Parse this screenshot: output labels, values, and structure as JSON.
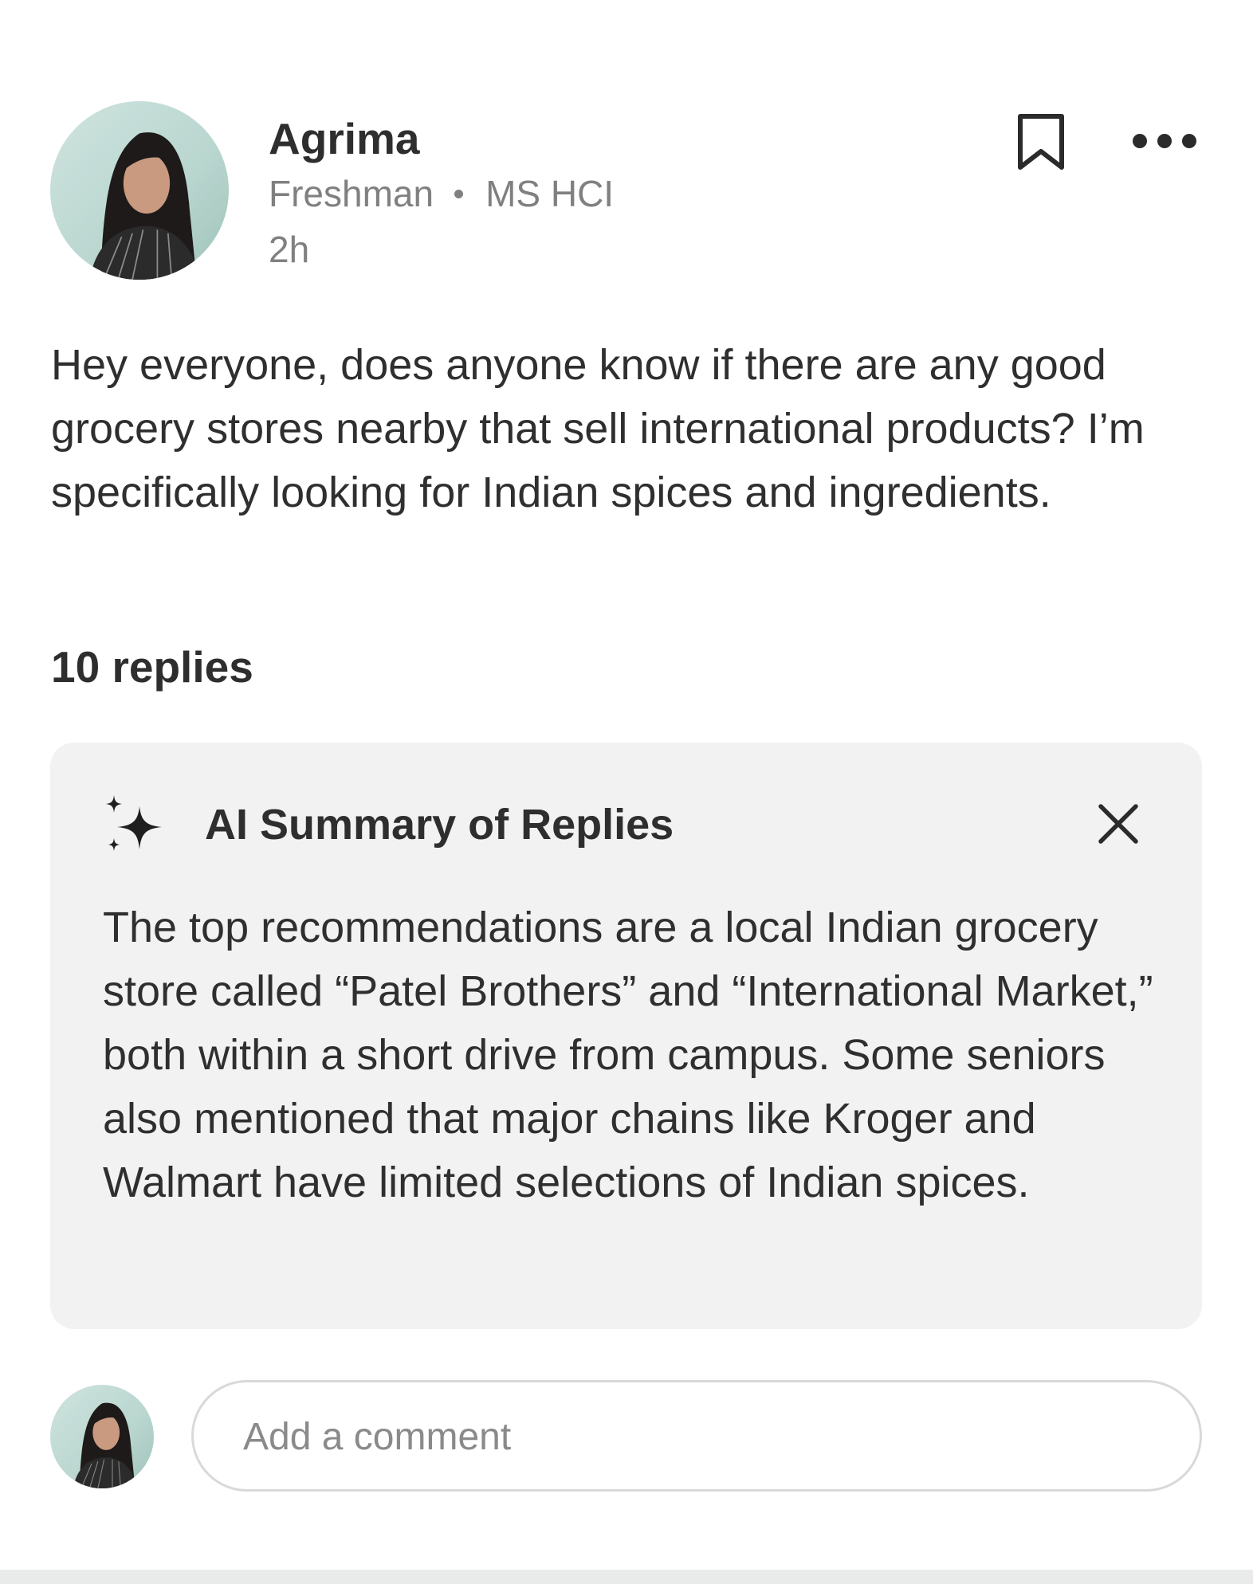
{
  "post": {
    "author": {
      "name": "Agrima",
      "year": "Freshman",
      "program": "MS HCI"
    },
    "time": "2h",
    "body": "Hey everyone, does anyone know if there are any good grocery stores nearby that sell international products? I’m specifically looking for Indian spices and ingredients.",
    "reply_count_label": "10 replies",
    "icons": {
      "bookmark": "bookmark-icon",
      "more": "more-options-icon"
    }
  },
  "ai_summary": {
    "title": "AI Summary of Replies",
    "icon": "sparkle-icon",
    "close_icon": "close-icon",
    "text": "The top recommendations are a local Indian grocery store called “Patel Brothers” and “International Market,” both within a short drive from campus. Some seniors also mentioned that major chains like Kroger and Walmart have limited selections of Indian spices."
  },
  "comment": {
    "placeholder": "Add a comment",
    "value": ""
  },
  "colors": {
    "card_background": "#f2f2f2",
    "secondary_text": "#808080",
    "primary_text": "#2e2e2e",
    "input_border": "#d9d9d9"
  }
}
